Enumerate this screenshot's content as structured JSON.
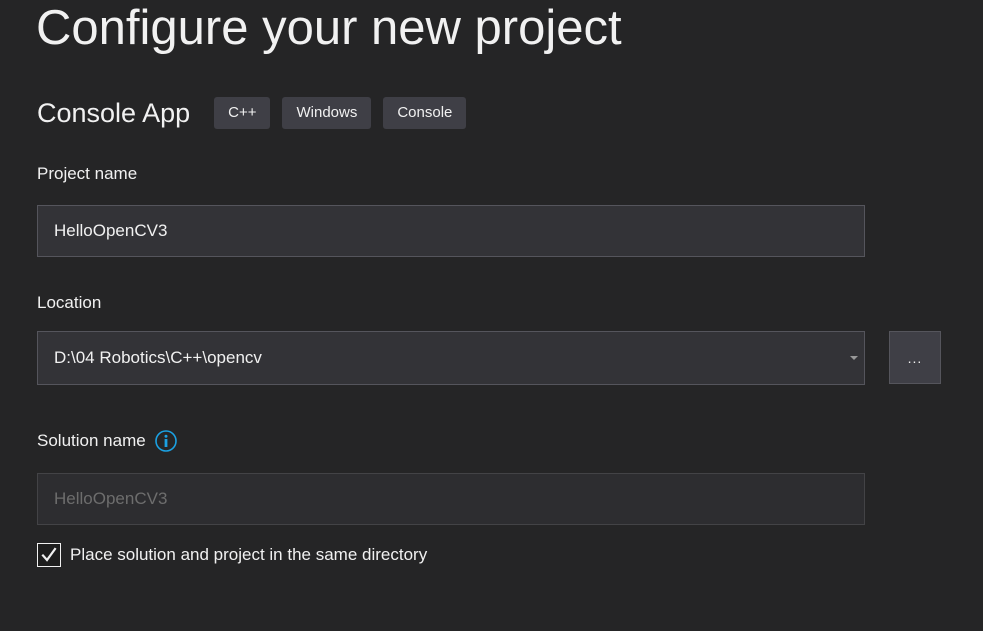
{
  "page": {
    "title": "Configure your new project"
  },
  "template": {
    "name": "Console App",
    "tags": [
      "C++",
      "Windows",
      "Console"
    ]
  },
  "project_name": {
    "label": "Project name",
    "value": "HelloOpenCV3"
  },
  "location": {
    "label": "Location",
    "value": "D:\\04 Robotics\\C++\\opencv",
    "browse_label": "..."
  },
  "solution_name": {
    "label": "Solution name",
    "value": "HelloOpenCV3",
    "disabled": true
  },
  "same_directory": {
    "label": "Place solution and project in the same directory",
    "checked": true
  },
  "colors": {
    "background": "#252526",
    "input_background": "#333337",
    "tag_background": "#3f3f46",
    "info_accent": "#1ba1e2",
    "text": "#f1f1f1",
    "disabled_text": "#6d6d6d"
  },
  "icons": {
    "info": "info-icon",
    "dropdown": "chevron-down-icon",
    "check": "checkmark-icon"
  }
}
